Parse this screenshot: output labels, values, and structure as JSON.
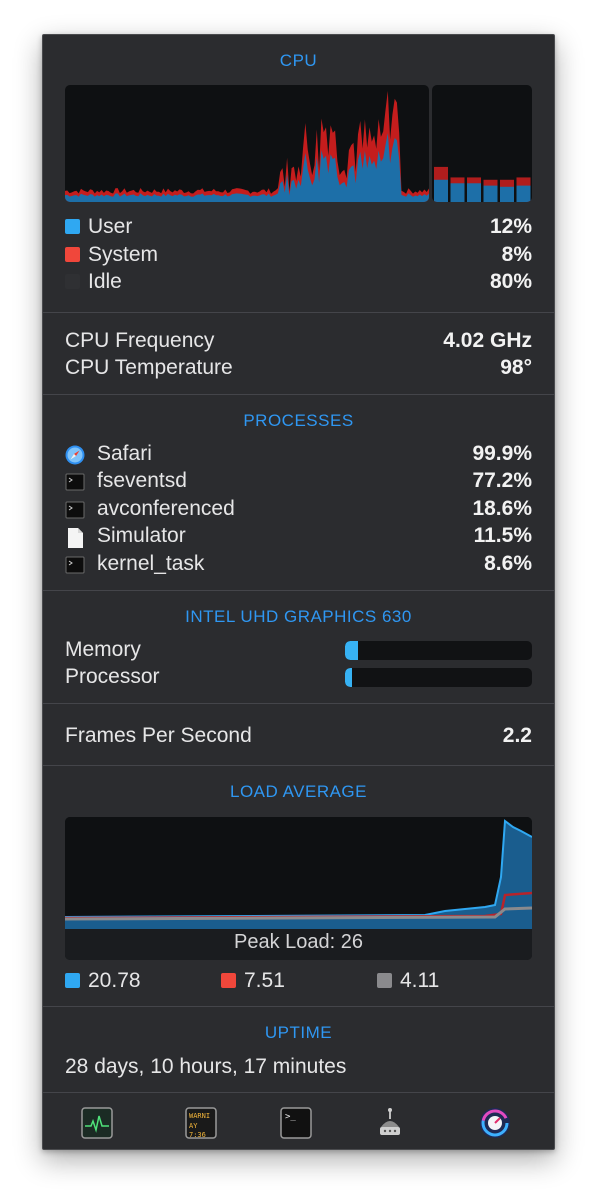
{
  "cpu": {
    "title": "CPU",
    "legend": [
      {
        "label": "User",
        "value": "12%",
        "color": "#2fa8f2"
      },
      {
        "label": "System",
        "value": "8%",
        "color": "#f0473b"
      },
      {
        "label": "Idle",
        "value": "80%",
        "color": "#2f3033"
      }
    ],
    "core_bars": [
      {
        "system": 0.3,
        "user": 0.19
      },
      {
        "system": 0.21,
        "user": 0.16
      },
      {
        "system": 0.21,
        "user": 0.16
      },
      {
        "system": 0.19,
        "user": 0.14
      },
      {
        "system": 0.19,
        "user": 0.13
      },
      {
        "system": 0.21,
        "user": 0.14
      }
    ]
  },
  "cpu_info": {
    "frequency_label": "CPU Frequency",
    "frequency_value": "4.02 GHz",
    "temperature_label": "CPU Temperature",
    "temperature_value": "98°"
  },
  "processes": {
    "title": "PROCESSES",
    "items": [
      {
        "name": "Safari",
        "value": "99.9%",
        "icon": "safari-icon"
      },
      {
        "name": "fseventsd",
        "value": "77.2%",
        "icon": "terminal-exec-icon"
      },
      {
        "name": "avconferenced",
        "value": "18.6%",
        "icon": "terminal-exec-icon"
      },
      {
        "name": "Simulator",
        "value": "11.5%",
        "icon": "document-icon"
      },
      {
        "name": "kernel_task",
        "value": "8.6%",
        "icon": "terminal-exec-icon"
      }
    ]
  },
  "gpu": {
    "title": "INTEL UHD GRAPHICS 630",
    "memory_label": "Memory",
    "memory_level": 0.07,
    "processor_label": "Processor",
    "processor_level": 0.04
  },
  "fps": {
    "label": "Frames Per Second",
    "value": "2.2"
  },
  "load": {
    "title": "LOAD AVERAGE",
    "peak_label": "Peak Load: 26",
    "legend": [
      {
        "value": "20.78",
        "color": "#2fa8f2"
      },
      {
        "value": "7.51",
        "color": "#f0473b"
      },
      {
        "value": "4.11",
        "color": "#8a8a8d"
      }
    ]
  },
  "uptime": {
    "title": "UPTIME",
    "value": "28 days, 10 hours, 17 minutes"
  },
  "dock": {
    "items": [
      {
        "name": "activity-monitor-icon"
      },
      {
        "name": "console-icon",
        "text_top": "WARNI",
        "text_bottom": "AY 7:36"
      },
      {
        "name": "terminal-icon",
        "text": ">_"
      },
      {
        "name": "disk-utility-icon"
      },
      {
        "name": "istat-menus-icon"
      }
    ]
  }
}
